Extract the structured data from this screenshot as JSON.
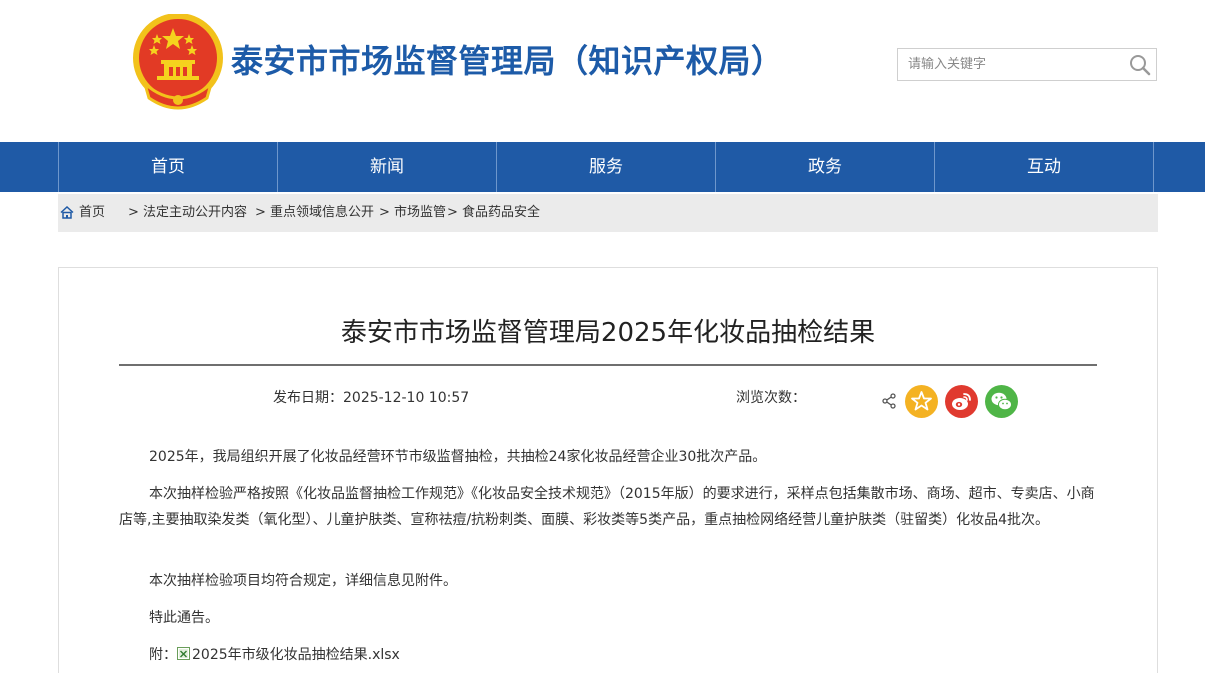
{
  "header": {
    "site_title": "泰安市市场监督管理局（知识产权局）",
    "emblem_icon": "national-emblem-icon",
    "search": {
      "placeholder": "请输入关键字",
      "icon": "search-icon"
    }
  },
  "nav": {
    "items": [
      {
        "label": "首页"
      },
      {
        "label": "新闻"
      },
      {
        "label": "服务"
      },
      {
        "label": "政务"
      },
      {
        "label": "互动"
      }
    ],
    "color": "#1f5aa6"
  },
  "breadcrumb": {
    "home": "首页",
    "items": [
      "> 法定主动公开内容",
      "> 重点领域信息公开",
      "> 市场监管",
      "> 食品药品安全"
    ]
  },
  "article": {
    "title": "泰安市市场监督管理局2025年化妆品抽检结果",
    "date_label": "发布日期：2025-12-10 10:57",
    "views_label": "浏览次数：",
    "share_icons": [
      "share-icon",
      "favorite-star-icon",
      "weibo-icon",
      "wechat-icon"
    ],
    "paragraphs": [
      "2025年，我局组织开展了化妆品经营环节市级监督抽检，共抽检24家化妆品经营企业30批次产品。",
      "本次抽样检验严格按照《化妆品监督抽检工作规范》《化妆品安全技术规范》（2015年版）的要求进行，采样点包括集散市场、商场、超市、专卖店、小商店等,主要抽取染发类（氧化型）、儿童护肤类、宣称祛痘/抗粉刺类、面膜、彩妆类等5类产品，重点抽检网络经营儿童护肤类（驻留类）化妆品4批次。",
      "本次抽样检验项目均符合规定，详细信息见附件。",
      "特此通告。"
    ],
    "attachment_prefix": "附：",
    "attachment_name": "2025年市级化妆品抽检结果.xlsx"
  }
}
